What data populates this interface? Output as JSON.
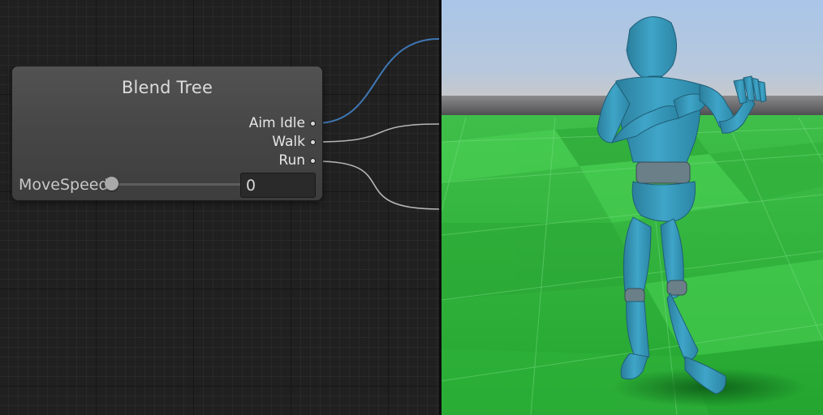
{
  "blend_tree": {
    "title": "Blend Tree",
    "outputs": [
      {
        "label": "Aim Idle"
      },
      {
        "label": "Walk"
      },
      {
        "label": "Run"
      }
    ],
    "parameter": {
      "label": "MoveSpeed",
      "value": "0",
      "slider_fraction": 0
    }
  },
  "colors": {
    "graph_background": "#202020",
    "node_background": "#474747",
    "active_connection": "#3f77b5",
    "inactive_connection": "#b5b5b5",
    "sky_top": "#a8c4e6",
    "ground": "#2fae3a",
    "character": "#3a9ebf"
  },
  "scene": {
    "content": "3D preview of a humanoid mannequin on a checkered ground plane"
  }
}
